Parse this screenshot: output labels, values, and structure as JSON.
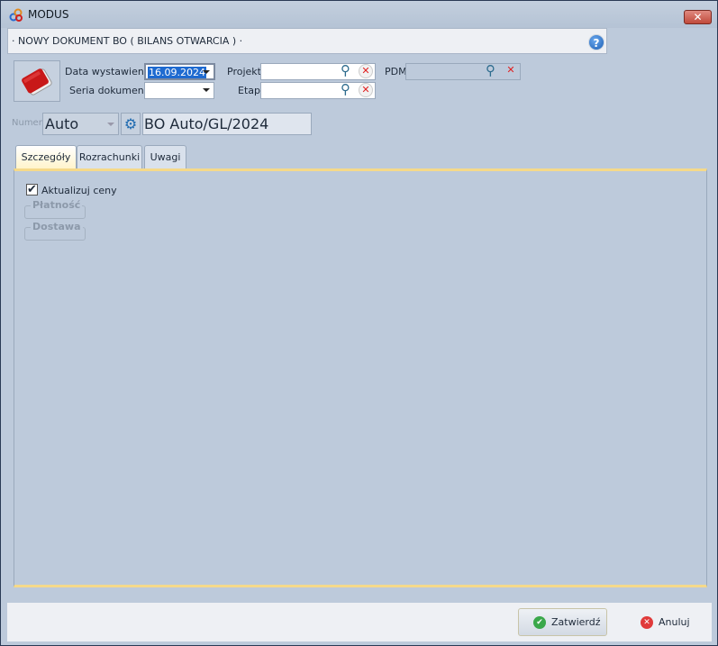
{
  "window": {
    "title": "MODUS",
    "close_label": "✕"
  },
  "header": {
    "title": "· NOWY DOKUMENT BO ( BILANS OTWARCIA ) ·",
    "help_label": "?"
  },
  "form": {
    "date_label": "Data wystawienia",
    "date_value": "16.09.2024",
    "series_label": "Seria dokumentu",
    "series_value": "",
    "project_label": "Projekt",
    "project_value": "",
    "stage_label": "Etap",
    "stage_value": "",
    "pdm_label": "PDM",
    "pdm_value": "",
    "number_label": "Numer",
    "number_mode": "Auto",
    "number_value": "BO Auto/GL/2024"
  },
  "tabs": [
    {
      "label": "Szczegóły",
      "active": true
    },
    {
      "label": "Rozrachunki"
    },
    {
      "label": "Uwagi"
    }
  ],
  "details": {
    "update_prices_label": "Aktualizuj ceny",
    "update_prices_checked": true,
    "payment_group": "Płatność",
    "delivery_group": "Dostawa"
  },
  "footer": {
    "confirm_label": "Zatwierdź",
    "cancel_label": "Anuluj"
  }
}
